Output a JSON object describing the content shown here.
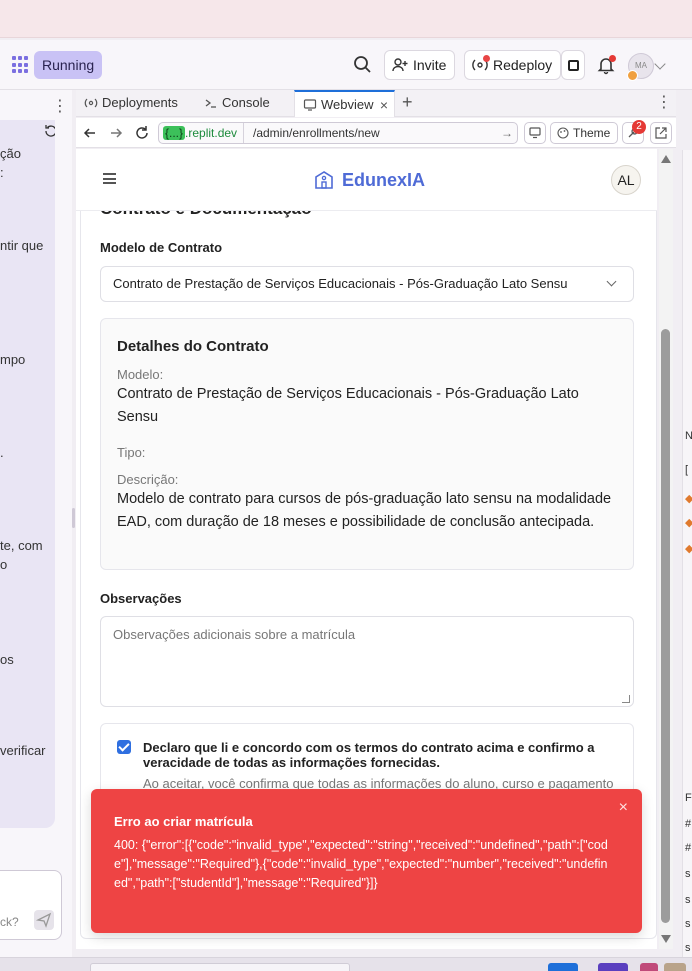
{
  "topbar": {
    "status": "Running",
    "invite_label": "Invite",
    "redeploy_label": "Redeploy",
    "user_initials": "MA"
  },
  "left_panel": {
    "fragments": [
      "ção",
      ":",
      "ntir que",
      "mpo",
      ".",
      "te, com",
      "o",
      "os",
      "verificar"
    ],
    "input_placeholder": "ck?"
  },
  "tabs": [
    {
      "label": "Deployments"
    },
    {
      "label": "Console"
    },
    {
      "label": "Webview"
    }
  ],
  "urlbar": {
    "host_badge": "{...}",
    "host": ".replit.dev",
    "path": "/admin/enrollments/new",
    "theme_label": "Theme",
    "notification_count": "2"
  },
  "app": {
    "brand": "EdunexIA",
    "user_initials": "AL"
  },
  "form": {
    "section_title": "Contrato e Documentação",
    "contract_model_label": "Modelo de Contrato",
    "contract_model_value": "Contrato de Prestação de Serviços Educacionais - Pós-Graduação Lato Sensu",
    "details": {
      "heading": "Detalhes do Contrato",
      "model_key": "Modelo:",
      "model_value": "Contrato de Prestação de Serviços Educacionais - Pós-Graduação Lato Sensu",
      "type_key": "Tipo:",
      "description_key": "Descrição:",
      "description_value": "Modelo de contrato para cursos de pós-graduação lato sensu na modalidade EAD, com duração de 18 meses e possibilidade de conclusão antecipada."
    },
    "notes_label": "Observações",
    "notes_placeholder": "Observações adicionais sobre a matrícula",
    "agree_text": "Declaro que li e concordo com os termos do contrato acima e confirmo a veracidade de todas as informações fornecidas.",
    "agree_subtext": "Ao aceitar, você confirma que todas as informações do aluno, curso e pagamento"
  },
  "toast": {
    "title": "Erro ao criar matrícula",
    "message": "400: {\"error\":[{\"code\":\"invalid_type\",\"expected\":\"string\",\"received\":\"undefined\",\"path\":[\"code\"],\"message\":\"Required\"},{\"code\":\"invalid_type\",\"expected\":\"number\",\"received\":\"undefined\",\"path\":[\"studentId\"],\"message\":\"Required\"}]}",
    "close_glyph": "×"
  },
  "colors": {
    "brand": "#4f6bd6",
    "toast_bg": "#ee4444",
    "checkbox": "#2f6fe0",
    "running_pill": "#c9c2f5"
  },
  "right_strip": [
    "N",
    "[",
    "◆",
    "◆",
    "◆",
    "F",
    "#",
    "#",
    "s",
    "s",
    "s",
    "s"
  ]
}
